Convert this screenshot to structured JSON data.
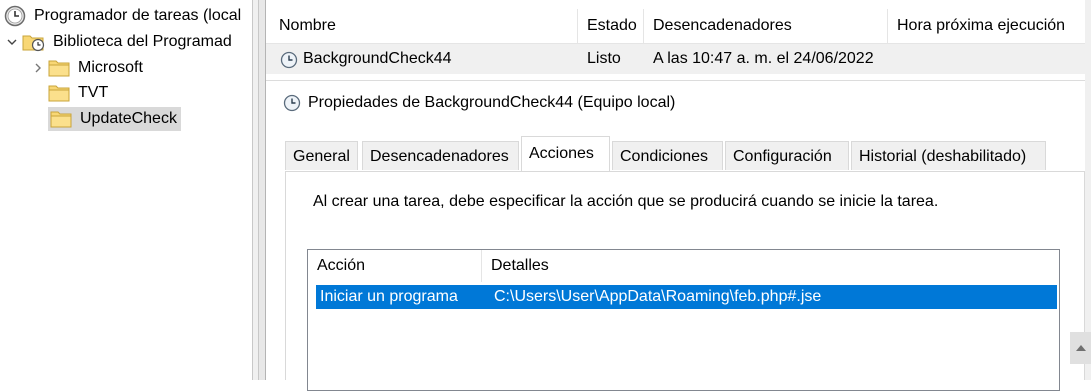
{
  "tree": {
    "root_label": "Programador de tareas (local",
    "library_label": "Biblioteca del Programad",
    "folders": [
      {
        "label": "Microsoft",
        "expandable": true
      },
      {
        "label": "TVT",
        "expandable": false
      },
      {
        "label": "UpdateCheck",
        "expandable": false,
        "selected": true
      }
    ]
  },
  "task_list": {
    "columns": [
      "Nombre",
      "Estado",
      "Desencadenadores",
      "Hora próxima ejecución"
    ],
    "row": {
      "name": "BackgroundCheck44",
      "status": "Listo",
      "trigger": "A las 10:47 a. m. el 24/06/2022"
    }
  },
  "properties": {
    "title": "Propiedades de BackgroundCheck44 (Equipo local)",
    "tabs": [
      "General",
      "Desencadenadores",
      "Acciones",
      "Condiciones",
      "Configuración",
      "Historial (deshabilitado)"
    ],
    "active_tab": "Acciones",
    "description": "Al crear una tarea, debe especificar la acción que se producirá cuando se inicie la tarea.",
    "actions_table": {
      "columns": [
        "Acción",
        "Detalles"
      ],
      "rows": [
        {
          "action": "Iniciar un programa",
          "details": "C:\\Users\\User\\AppData\\Roaming\\feb.php#.jse"
        }
      ]
    }
  },
  "colors": {
    "selection_blue": "#0078d7",
    "folder_yellow": "#f8d775",
    "tree_selected": "#d9d9d9"
  },
  "icons": [
    "clock-icon",
    "library-icon",
    "folder-icon",
    "chevron-right-icon",
    "chevron-down-icon",
    "task-clock-icon",
    "scroll-up-icon"
  ]
}
